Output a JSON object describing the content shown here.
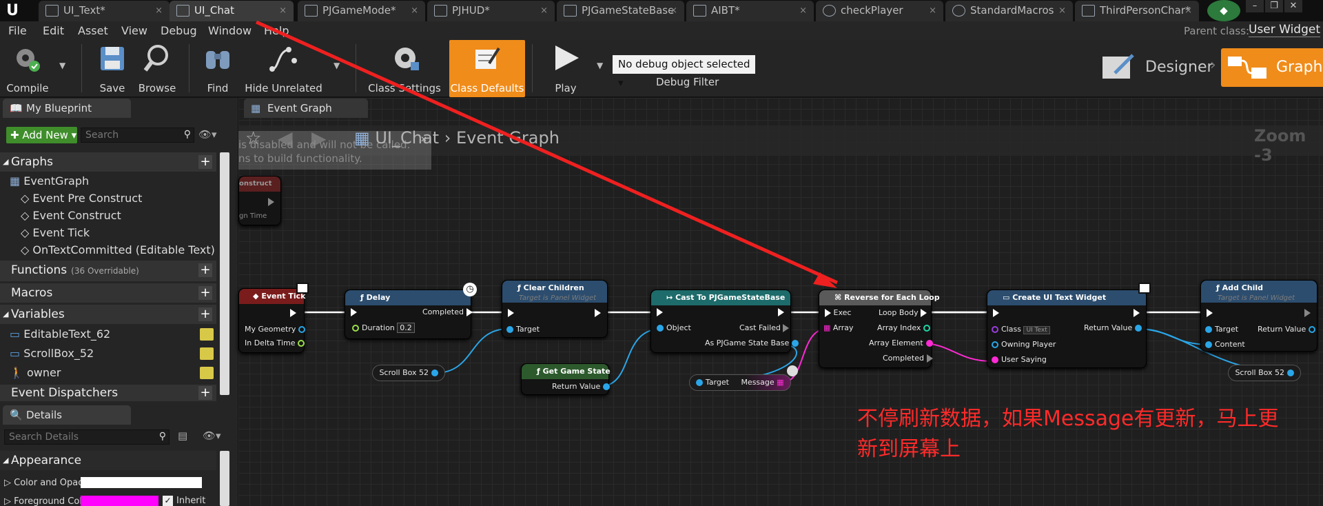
{
  "tabs": [
    {
      "label": "UI_Text*",
      "active": false
    },
    {
      "label": "UI_Chat",
      "active": true
    },
    {
      "label": "PJGameMode*",
      "active": false
    },
    {
      "label": "PJHUD*",
      "active": false
    },
    {
      "label": "PJGameStateBase",
      "active": false
    },
    {
      "label": "AIBT*",
      "active": false
    },
    {
      "label": "checkPlayer",
      "active": false
    },
    {
      "label": "StandardMacros",
      "active": false
    },
    {
      "label": "ThirdPersonChar*",
      "active": false
    }
  ],
  "menu": [
    "File",
    "Edit",
    "Asset",
    "View",
    "Debug",
    "Window",
    "Help"
  ],
  "parent_class_label": "Parent class:",
  "parent_class_value": "User Widget",
  "toolbar": {
    "compile": "Compile",
    "save": "Save",
    "browse": "Browse",
    "find": "Find",
    "hide_unrelated": "Hide Unrelated",
    "class_settings": "Class Settings",
    "class_defaults": "Class Defaults",
    "play": "Play",
    "debug_object": "No debug object selected",
    "debug_filter": "Debug Filter",
    "designer": "Designer",
    "graph": "Graph"
  },
  "my_blueprint": {
    "tab": "My Blueprint",
    "add_new": "Add New",
    "search_placeholder": "Search",
    "graphs_header": "Graphs",
    "event_graph": "EventGraph",
    "events": [
      "Event Pre Construct",
      "Event Construct",
      "Event Tick",
      "OnTextCommitted (Editable Text)"
    ],
    "functions_header": "Functions",
    "functions_note": "(36 Overridable)",
    "macros_header": "Macros",
    "variables_header": "Variables",
    "variables": [
      "EditableText_62",
      "ScrollBox_52",
      "owner"
    ],
    "dispatchers_header": "Event Dispatchers"
  },
  "details": {
    "tab": "Details",
    "search_placeholder": "Search Details",
    "appearance_header": "Appearance",
    "row1": "Color and Opac",
    "row2": "Foreground Col",
    "inherit": "Inherit"
  },
  "graph": {
    "tab": "Event Graph",
    "breadcrumb_bp": "UI_Chat",
    "breadcrumb_graph": "Event Graph",
    "zoom": "Zoom -3",
    "warning_line1": "is disabled and will not be called.",
    "warning_line2": "ns to build functionality.",
    "ghost_node_title": "onstruct",
    "ghost_node_pin": "gn Time"
  },
  "nodes": {
    "event_tick": {
      "title": "Event Tick",
      "pins": [
        "My Geometry",
        "In Delta Time"
      ]
    },
    "delay": {
      "title": "Delay",
      "completed": "Completed",
      "duration_label": "Duration",
      "duration_value": "0.2"
    },
    "clear_children": {
      "title": "Clear Children",
      "subtitle": "Target is Panel Widget",
      "target": "Target"
    },
    "cast": {
      "title": "Cast To PJGameStateBase",
      "object": "Object",
      "cast_failed": "Cast Failed",
      "as": "As PJGame State Base"
    },
    "reverse_loop": {
      "title": "Reverse for Each Loop",
      "exec": "Exec",
      "array": "Array",
      "loop_body": "Loop Body",
      "array_index": "Array Index",
      "array_element": "Array Element",
      "completed": "Completed"
    },
    "create_widget": {
      "title": "Create UI Text Widget",
      "class": "Class",
      "class_value": "UI Text",
      "owning_player": "Owning Player",
      "user_saying": "User Saying",
      "return_value": "Return Value"
    },
    "add_child": {
      "title": "Add Child",
      "subtitle": "Target is Panel Widget",
      "target": "Target",
      "content": "Content",
      "return_value": "Return Value"
    },
    "get_game_state": {
      "title": "Get Game State",
      "return_value": "Return Value"
    },
    "scroll_box_a": "Scroll Box 52",
    "scroll_box_b": "Scroll Box 52",
    "message_target": "Target",
    "message_label": "Message"
  },
  "annotation": {
    "line1": "不停刷新数据，如果Message有更新，马上更",
    "line2": "新到屏幕上"
  }
}
